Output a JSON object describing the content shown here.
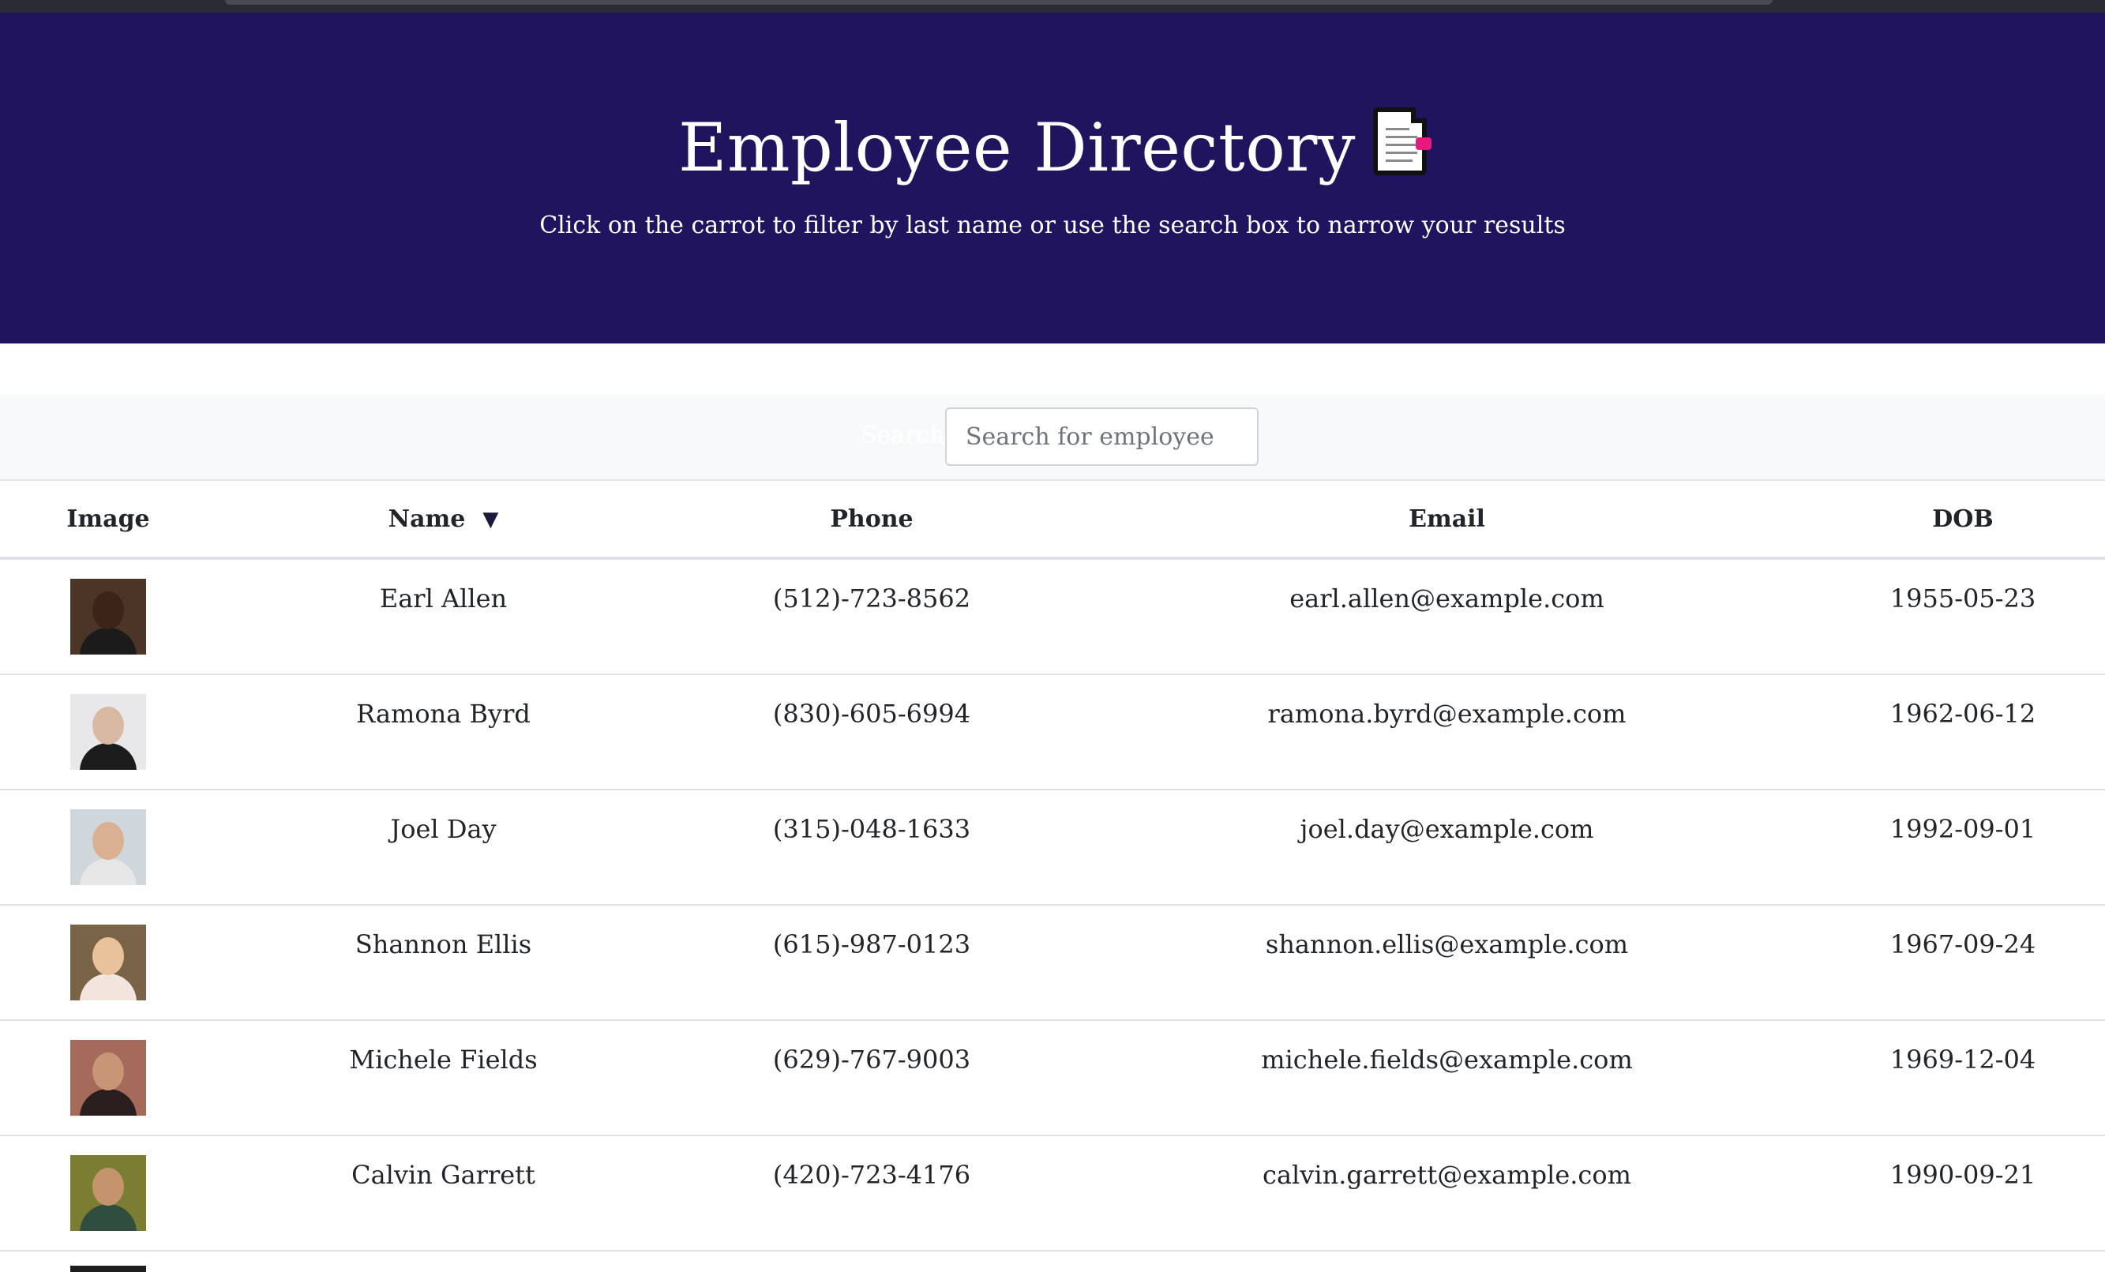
{
  "header": {
    "title": "Employee Directory",
    "subtitle": "Click on the carrot to filter by last name or use the search box to narrow your results",
    "icon": "document-icon"
  },
  "search": {
    "label": "Search:",
    "placeholder": "Search for employee",
    "value": ""
  },
  "table": {
    "columns": {
      "image": "Image",
      "name": "Name",
      "sort_indicator": "▼",
      "phone": "Phone",
      "email": "Email",
      "dob": "DOB"
    },
    "rows": [
      {
        "name": "Earl Allen",
        "phone": "(512)-723-8562",
        "email": "earl.allen@example.com",
        "dob": "1955-05-23",
        "avatar": {
          "bg": "#4a3526",
          "skin": "#3b2418",
          "shirt": "#1b1b1b"
        }
      },
      {
        "name": "Ramona Byrd",
        "phone": "(830)-605-6994",
        "email": "ramona.byrd@example.com",
        "dob": "1962-06-12",
        "avatar": {
          "bg": "#e8e8ea",
          "skin": "#d9b8a4",
          "shirt": "#1c1c1c"
        }
      },
      {
        "name": "Joel Day",
        "phone": "(315)-048-1633",
        "email": "joel.day@example.com",
        "dob": "1992-09-01",
        "avatar": {
          "bg": "#cfd6dc",
          "skin": "#d9b092",
          "shirt": "#e6e6e6"
        }
      },
      {
        "name": "Shannon Ellis",
        "phone": "(615)-987-0123",
        "email": "shannon.ellis@example.com",
        "dob": "1967-09-24",
        "avatar": {
          "bg": "#7a6448",
          "skin": "#e7c29a",
          "shirt": "#f1e5de"
        }
      },
      {
        "name": "Michele Fields",
        "phone": "(629)-767-9003",
        "email": "michele.fields@example.com",
        "dob": "1969-12-04",
        "avatar": {
          "bg": "#a56a5a",
          "skin": "#c89676",
          "shirt": "#2a1e1e"
        }
      },
      {
        "name": "Calvin Garrett",
        "phone": "(420)-723-4176",
        "email": "calvin.garrett@example.com",
        "dob": "1990-09-21",
        "avatar": {
          "bg": "#7b7d33",
          "skin": "#c5946c",
          "shirt": "#2f4e3e"
        }
      }
    ]
  }
}
